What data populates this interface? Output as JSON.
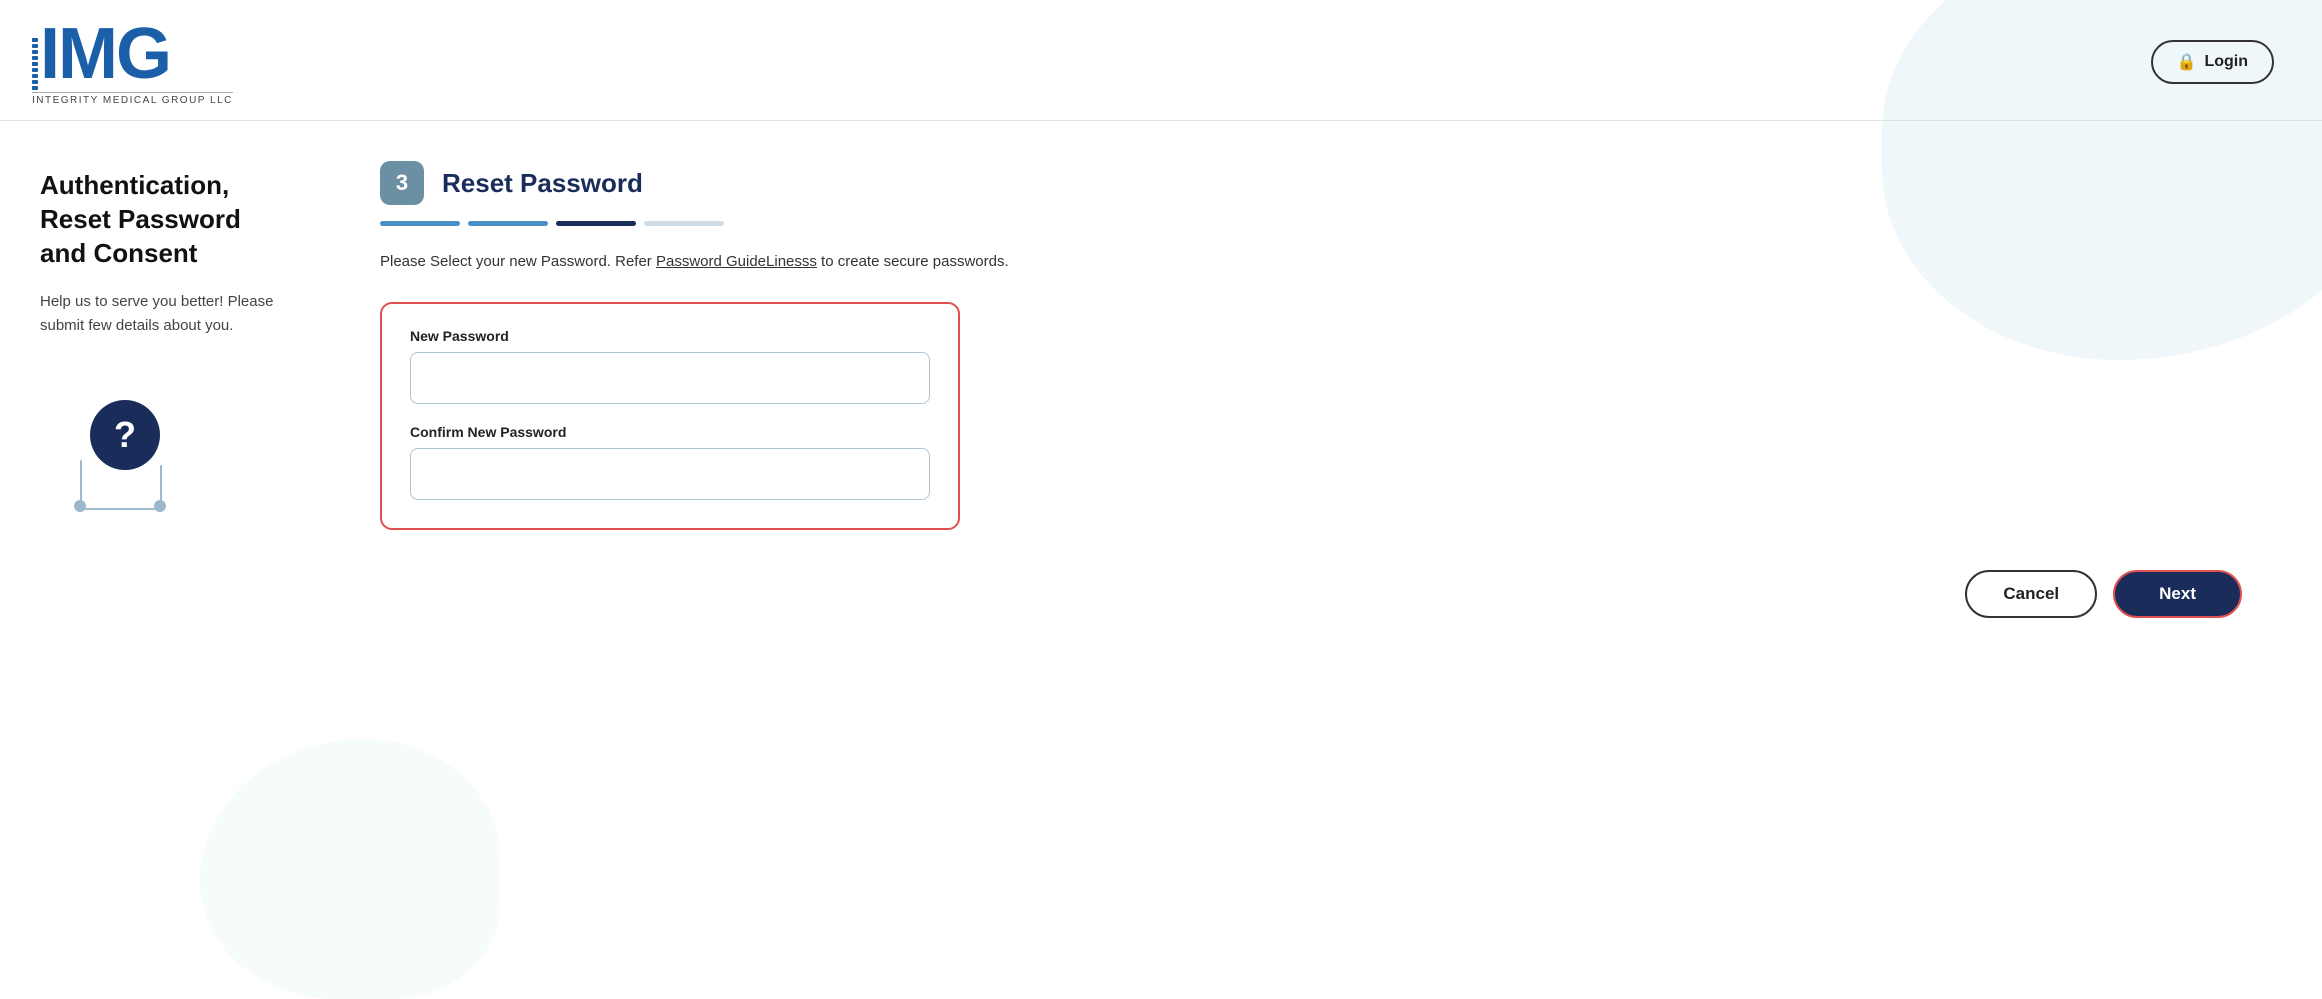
{
  "header": {
    "login_label": "Login",
    "logo_letters": "IMG",
    "logo_tagline": "INTEGRITY MEDICAL GROUP LLC"
  },
  "left_panel": {
    "title": "Authentication, Reset Password and Consent",
    "description": "Help us to serve you better! Please submit few details about you."
  },
  "main": {
    "step_number": "3",
    "step_title": "Reset Password",
    "description_prefix": "Please Select your new Password. Refer ",
    "guidelines_link_text": "Password GuideLinesss",
    "description_suffix": " to create secure passwords.",
    "progress_bars": [
      {
        "type": "blue"
      },
      {
        "type": "blue"
      },
      {
        "type": "dark"
      },
      {
        "type": "light"
      }
    ],
    "form": {
      "new_password_label": "New Password",
      "new_password_placeholder": "",
      "confirm_password_label": "Confirm New Password",
      "confirm_password_placeholder": ""
    },
    "buttons": {
      "cancel_label": "Cancel",
      "next_label": "Next"
    }
  }
}
